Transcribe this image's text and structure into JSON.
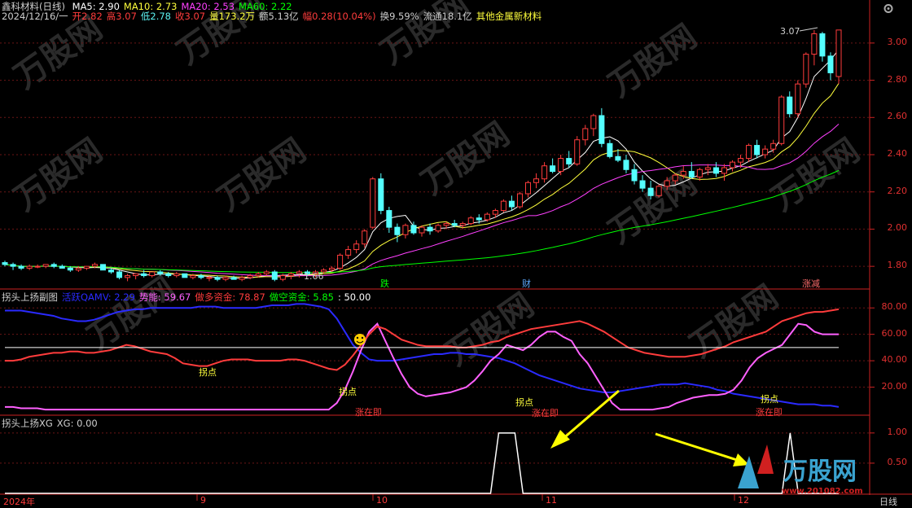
{
  "window": {
    "title": "鑫科材料(日线)",
    "ma_labels": [
      {
        "text": "MA5: 2.90",
        "color": "#ffffff"
      },
      {
        "text": "MA10: 2.73",
        "color": "#ffff3c"
      },
      {
        "text": "MA20: 2.53",
        "color": "#ff40ff"
      },
      {
        "text": "MA60: 2.22",
        "color": "#00ff00"
      }
    ],
    "info_line": [
      {
        "text": "2024/12/16/一",
        "color": "#cfcfcf"
      },
      {
        "text": "开2.82",
        "color": "#ff3c3c"
      },
      {
        "text": "高3.07",
        "color": "#ff3c3c"
      },
      {
        "text": "低2.78",
        "color": "#5cf2f2"
      },
      {
        "text": "收3.07",
        "color": "#ff3c3c"
      },
      {
        "text": "量173.2万",
        "color": "#ffff3c"
      },
      {
        "text": "额5.13亿",
        "color": "#cfcfcf"
      },
      {
        "text": "幅0.28(10.04%)",
        "color": "#ff3c3c"
      },
      {
        "text": "换9.59%",
        "color": "#cfcfcf"
      },
      {
        "text": "流通18.1亿",
        "color": "#cfcfcf"
      },
      {
        "text": "其他金属新材料",
        "color": "#ffff3c"
      }
    ]
  },
  "sub1_header": [
    {
      "text": "拐头上扬副图",
      "color": "#cfcfcf"
    },
    {
      "text": "活跃QAMV: 2.29",
      "color": "#2a2aff"
    },
    {
      "text": "势能: 59.67",
      "color": "#ff60ff"
    },
    {
      "text": "做多资金: 78.87",
      "color": "#ff3c3c"
    },
    {
      "text": "做空资金: 5.85",
      "color": "#00ff00"
    },
    {
      "text": ": 50.00",
      "color": "#ffffff"
    }
  ],
  "sub2_header": [
    {
      "text": "拐头上扬XG",
      "color": "#cfcfcf"
    },
    {
      "text": "XG: 0.00",
      "color": "#cfcfcf"
    }
  ],
  "price_axis": [
    "3.00",
    "2.80",
    "2.60",
    "2.40",
    "2.20",
    "2.00",
    "1.80"
  ],
  "sub1_axis": [
    "80.00",
    "60.00",
    "40.00",
    "20.00"
  ],
  "sub2_axis": [
    "1.00",
    "0.50"
  ],
  "date_axis": [
    {
      "text": "2024年",
      "color": "#ff3c3c"
    },
    {
      "text": "9",
      "color": "#ff3c3c"
    },
    {
      "text": "10",
      "color": "#ff3c3c"
    },
    {
      "text": "11",
      "color": "#ff3c3c"
    },
    {
      "text": "12",
      "color": "#ff3c3c"
    },
    {
      "text": "日线",
      "color": "#cfcfcf"
    }
  ],
  "markers": {
    "die": "跌",
    "cai": "财",
    "zhangjian": "涨减",
    "high_label": "3.07",
    "low_label": "1.66"
  },
  "sub1_annotations": [
    {
      "text": "拐点",
      "color": "#ffff3c"
    },
    {
      "text": "拐点",
      "color": "#ffff3c"
    },
    {
      "text": "涨在即",
      "color": "#ff3c3c"
    },
    {
      "text": "拐点",
      "color": "#ffff3c"
    },
    {
      "text": "涨在即",
      "color": "#ff3c3c"
    },
    {
      "text": "拐点",
      "color": "#ffff3c"
    },
    {
      "text": "涨在即",
      "color": "#ff3c3c"
    }
  ],
  "watermark": {
    "brand": "万股网",
    "url": "www.201082.com"
  },
  "chart_data": [
    {
      "type": "candlestick",
      "title": "鑫科材料(日线)",
      "ylim": [
        1.7,
        3.1
      ],
      "candles": [
        [
          1.82,
          1.83,
          1.8,
          1.81
        ],
        [
          1.81,
          1.82,
          1.78,
          1.8
        ],
        [
          1.8,
          1.81,
          1.78,
          1.79
        ],
        [
          1.79,
          1.81,
          1.78,
          1.8
        ],
        [
          1.8,
          1.81,
          1.79,
          1.8
        ],
        [
          1.8,
          1.81,
          1.79,
          1.81
        ],
        [
          1.81,
          1.82,
          1.79,
          1.8
        ],
        [
          1.8,
          1.81,
          1.79,
          1.79
        ],
        [
          1.79,
          1.8,
          1.77,
          1.78
        ],
        [
          1.78,
          1.8,
          1.77,
          1.79
        ],
        [
          1.79,
          1.8,
          1.78,
          1.8
        ],
        [
          1.8,
          1.82,
          1.79,
          1.81
        ],
        [
          1.81,
          1.81,
          1.78,
          1.78
        ],
        [
          1.78,
          1.79,
          1.76,
          1.77
        ],
        [
          1.77,
          1.78,
          1.73,
          1.74
        ],
        [
          1.74,
          1.76,
          1.72,
          1.75
        ],
        [
          1.75,
          1.76,
          1.73,
          1.76
        ],
        [
          1.76,
          1.78,
          1.74,
          1.75
        ],
        [
          1.75,
          1.77,
          1.74,
          1.77
        ],
        [
          1.77,
          1.78,
          1.75,
          1.76
        ],
        [
          1.76,
          1.77,
          1.74,
          1.75
        ],
        [
          1.75,
          1.77,
          1.74,
          1.76
        ],
        [
          1.76,
          1.76,
          1.74,
          1.74
        ],
        [
          1.74,
          1.76,
          1.73,
          1.75
        ],
        [
          1.75,
          1.76,
          1.73,
          1.74
        ],
        [
          1.74,
          1.75,
          1.72,
          1.74
        ],
        [
          1.74,
          1.75,
          1.72,
          1.73
        ],
        [
          1.73,
          1.75,
          1.72,
          1.74
        ],
        [
          1.74,
          1.75,
          1.73,
          1.73
        ],
        [
          1.73,
          1.75,
          1.72,
          1.74
        ],
        [
          1.74,
          1.76,
          1.73,
          1.75
        ],
        [
          1.75,
          1.77,
          1.74,
          1.76
        ],
        [
          1.76,
          1.78,
          1.75,
          1.77
        ],
        [
          1.77,
          1.78,
          1.72,
          1.73
        ],
        [
          1.73,
          1.76,
          1.72,
          1.75
        ],
        [
          1.75,
          1.77,
          1.73,
          1.76
        ],
        [
          1.76,
          1.78,
          1.74,
          1.77
        ],
        [
          1.77,
          1.78,
          1.75,
          1.76
        ],
        [
          1.76,
          1.78,
          1.74,
          1.77
        ],
        [
          1.77,
          1.79,
          1.76,
          1.78
        ],
        [
          1.78,
          1.8,
          1.77,
          1.79
        ],
        [
          1.79,
          1.87,
          1.78,
          1.86
        ],
        [
          1.86,
          1.91,
          1.84,
          1.89
        ],
        [
          1.89,
          1.94,
          1.87,
          1.92
        ],
        [
          1.92,
          2.0,
          1.9,
          1.99
        ],
        [
          2.01,
          2.28,
          2.0,
          2.27
        ],
        [
          2.27,
          2.3,
          2.08,
          2.1
        ],
        [
          2.1,
          2.12,
          1.98,
          2.01
        ],
        [
          2.01,
          2.03,
          1.93,
          1.97
        ],
        [
          1.97,
          2.03,
          1.95,
          2.02
        ],
        [
          2.02,
          2.04,
          1.97,
          1.98
        ],
        [
          1.98,
          2.02,
          1.96,
          2.01
        ],
        [
          2.01,
          2.03,
          1.97,
          1.99
        ],
        [
          1.99,
          2.03,
          1.98,
          2.02
        ],
        [
          2.02,
          2.04,
          2.0,
          2.03
        ],
        [
          2.03,
          2.05,
          2.01,
          2.02
        ],
        [
          2.02,
          2.04,
          2.0,
          2.03
        ],
        [
          2.03,
          2.07,
          2.02,
          2.06
        ],
        [
          2.06,
          2.08,
          2.03,
          2.05
        ],
        [
          2.05,
          2.09,
          2.04,
          2.08
        ],
        [
          2.08,
          2.11,
          2.06,
          2.1
        ],
        [
          2.1,
          2.16,
          2.09,
          2.15
        ],
        [
          2.15,
          2.18,
          2.1,
          2.12
        ],
        [
          2.12,
          2.2,
          2.11,
          2.19
        ],
        [
          2.19,
          2.26,
          2.17,
          2.25
        ],
        [
          2.25,
          2.3,
          2.22,
          2.27
        ],
        [
          2.27,
          2.36,
          2.25,
          2.34
        ],
        [
          2.34,
          2.38,
          2.3,
          2.31
        ],
        [
          2.31,
          2.4,
          2.29,
          2.38
        ],
        [
          2.38,
          2.42,
          2.33,
          2.35
        ],
        [
          2.35,
          2.5,
          2.34,
          2.48
        ],
        [
          2.48,
          2.56,
          2.45,
          2.54
        ],
        [
          2.54,
          2.62,
          2.5,
          2.61
        ],
        [
          2.61,
          2.65,
          2.44,
          2.46
        ],
        [
          2.46,
          2.48,
          2.38,
          2.39
        ],
        [
          2.39,
          2.43,
          2.36,
          2.37
        ],
        [
          2.37,
          2.4,
          2.3,
          2.32
        ],
        [
          2.32,
          2.35,
          2.24,
          2.26
        ],
        [
          2.26,
          2.29,
          2.2,
          2.22
        ],
        [
          2.22,
          2.26,
          2.16,
          2.18
        ],
        [
          2.18,
          2.24,
          2.17,
          2.23
        ],
        [
          2.23,
          2.28,
          2.21,
          2.26
        ],
        [
          2.26,
          2.3,
          2.24,
          2.29
        ],
        [
          2.29,
          2.34,
          2.27,
          2.31
        ],
        [
          2.31,
          2.36,
          2.27,
          2.28
        ],
        [
          2.28,
          2.33,
          2.26,
          2.32
        ],
        [
          2.32,
          2.35,
          2.29,
          2.33
        ],
        [
          2.33,
          2.36,
          2.28,
          2.3
        ],
        [
          2.3,
          2.35,
          2.26,
          2.33
        ],
        [
          2.33,
          2.37,
          2.31,
          2.36
        ],
        [
          2.36,
          2.4,
          2.33,
          2.38
        ],
        [
          2.38,
          2.46,
          2.36,
          2.45
        ],
        [
          2.45,
          2.48,
          2.38,
          2.4
        ],
        [
          2.4,
          2.45,
          2.38,
          2.43
        ],
        [
          2.43,
          2.48,
          2.41,
          2.46
        ],
        [
          2.46,
          2.72,
          2.45,
          2.71
        ],
        [
          2.71,
          2.74,
          2.6,
          2.62
        ],
        [
          2.62,
          2.8,
          2.6,
          2.78
        ],
        [
          2.78,
          2.95,
          2.76,
          2.94
        ],
        [
          2.94,
          3.07,
          2.88,
          3.05
        ],
        [
          3.05,
          3.06,
          2.9,
          2.93
        ],
        [
          2.93,
          2.95,
          2.8,
          2.84
        ],
        [
          2.82,
          3.07,
          2.78,
          3.07
        ]
      ],
      "ma_values": {
        "MA5": 2.9,
        "MA10": 2.73,
        "MA20": 2.53,
        "MA60": 2.22
      },
      "annotations": [
        "3.07",
        "1.66"
      ]
    },
    {
      "type": "line",
      "title": "拐头上扬副图",
      "ylim": [
        0,
        100
      ],
      "series": [
        {
          "name": "活跃QAMV",
          "color": "#2a2aff",
          "values": [
            78,
            78,
            78,
            77,
            76,
            75,
            74,
            72,
            71,
            70,
            70,
            71,
            73,
            75,
            77,
            78,
            79,
            79,
            80,
            80,
            80,
            80,
            80,
            80,
            81,
            81,
            81,
            80,
            80,
            80,
            80,
            80,
            81,
            82,
            82,
            82,
            83,
            83,
            82,
            81,
            79,
            72,
            62,
            52,
            46,
            41,
            40,
            40,
            40,
            41,
            42,
            43,
            44,
            45,
            45,
            46,
            46,
            45,
            45,
            44,
            43,
            42,
            40,
            38,
            35,
            32,
            29,
            27,
            25,
            23,
            21,
            19,
            18,
            17,
            16,
            16,
            17,
            18,
            19,
            20,
            21,
            22,
            22,
            22,
            23,
            22,
            21,
            20,
            18,
            17,
            15,
            14,
            13,
            12,
            11,
            10,
            9,
            8,
            7,
            7,
            7,
            6,
            6,
            5
          ]
        },
        {
          "name": "势能",
          "color": "#ff60ff",
          "values": [
            5,
            5,
            4,
            4,
            4,
            3,
            3,
            3,
            3,
            3,
            3,
            3,
            3,
            3,
            3,
            3,
            3,
            3,
            3,
            3,
            3,
            3,
            3,
            3,
            3,
            3,
            3,
            3,
            3,
            3,
            3,
            3,
            3,
            3,
            3,
            3,
            3,
            3,
            3,
            3,
            3,
            8,
            18,
            32,
            48,
            62,
            68,
            55,
            42,
            30,
            20,
            15,
            13,
            14,
            15,
            16,
            18,
            20,
            25,
            32,
            40,
            45,
            52,
            50,
            48,
            52,
            58,
            62,
            62,
            58,
            55,
            45,
            38,
            28,
            18,
            8,
            3,
            3,
            3,
            3,
            3,
            4,
            5,
            8,
            10,
            12,
            13,
            14,
            14,
            15,
            18,
            25,
            35,
            42,
            46,
            49,
            52,
            60,
            68,
            67,
            62,
            60,
            60,
            60
          ]
        },
        {
          "name": "做多资金",
          "color": "#ff3c3c",
          "values": [
            40,
            40,
            41,
            43,
            44,
            45,
            46,
            46,
            47,
            47,
            46,
            46,
            47,
            48,
            50,
            52,
            51,
            49,
            47,
            46,
            45,
            42,
            38,
            37,
            36,
            36,
            38,
            40,
            41,
            41,
            41,
            40,
            40,
            40,
            40,
            41,
            41,
            40,
            38,
            36,
            34,
            33,
            37,
            44,
            52,
            60,
            66,
            64,
            60,
            56,
            54,
            52,
            51,
            51,
            51,
            51,
            50,
            50,
            51,
            52,
            54,
            55,
            58,
            60,
            62,
            64,
            65,
            66,
            67,
            68,
            69,
            70,
            68,
            65,
            62,
            58,
            54,
            50,
            48,
            46,
            45,
            44,
            43,
            43,
            43,
            44,
            45,
            47,
            49,
            51,
            54,
            56,
            58,
            60,
            62,
            66,
            70,
            72,
            74,
            76,
            77,
            77,
            78,
            79
          ]
        },
        {
          "name": "50.00",
          "color": "#ffffff",
          "constant": 50
        }
      ],
      "annotations": [
        "拐点",
        "拐点",
        "涨在即",
        "拐点",
        "涨在即",
        "拐点",
        "涨在即"
      ]
    },
    {
      "type": "line",
      "title": "拐头上扬XG",
      "ylim": [
        0,
        1.2
      ],
      "series": [
        {
          "name": "XG",
          "color": "#ffffff",
          "values": [
            0,
            0,
            0,
            0,
            0,
            0,
            0,
            0,
            0,
            0,
            0,
            0,
            0,
            0,
            0,
            0,
            0,
            0,
            0,
            0,
            0,
            0,
            0,
            0,
            0,
            0,
            0,
            0,
            0,
            0,
            0,
            0,
            0,
            0,
            0,
            0,
            0,
            0,
            0,
            0,
            0,
            0,
            0,
            0,
            0,
            0,
            0,
            0,
            0,
            0,
            0,
            0,
            0,
            0,
            0,
            0,
            0,
            0,
            0,
            0,
            0,
            1,
            1,
            1,
            0,
            0,
            0,
            0,
            0,
            0,
            0,
            0,
            0,
            0,
            0,
            0,
            0,
            0,
            0,
            0,
            0,
            0,
            0,
            0,
            0,
            0,
            0,
            0,
            0,
            0,
            0,
            0,
            0,
            0,
            0,
            0,
            0,
            1,
            0,
            0,
            0,
            0,
            0,
            0
          ]
        }
      ]
    }
  ]
}
